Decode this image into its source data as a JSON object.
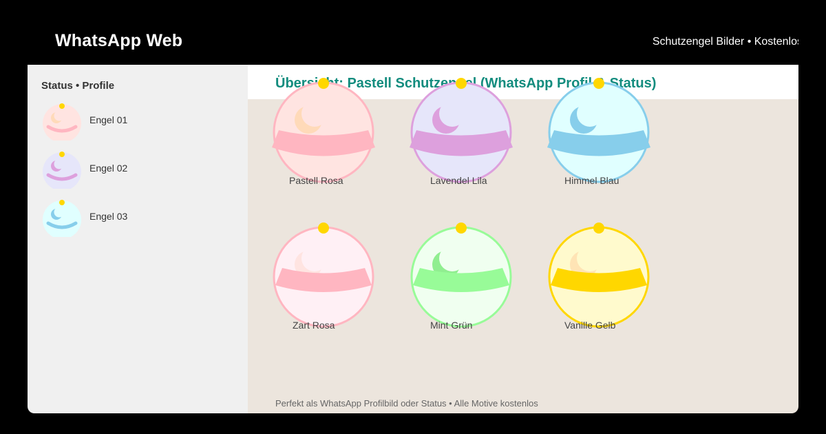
{
  "header": {
    "app_title": "WhatsApp Web",
    "right_text": "Schutzengel Bilder • Kostenlos"
  },
  "sidebar": {
    "title": "Status • Profile",
    "items": [
      {
        "label": "Engel 01",
        "fill": "#FFE4E1",
        "accent": "#FFB6C1",
        "moon": "#FFDAB9",
        "halo": "#FFD700"
      },
      {
        "label": "Engel 02",
        "fill": "#E6E6FA",
        "accent": "#DDA0DD",
        "moon": "#DDA0DD",
        "halo": "#FFD700"
      },
      {
        "label": "Engel 03",
        "fill": "#E0FFFF",
        "accent": "#87CEEB",
        "moon": "#87CEEB",
        "halo": "#FFD700"
      }
    ]
  },
  "main": {
    "title": "Übersicht: Pastell Schutzengel (WhatsApp Profil & Status)",
    "cards": [
      {
        "label": "Pastell Rosa",
        "fill": "#FFE4E1",
        "stroke": "#FFB6C1",
        "wing": "#FFB6C1",
        "moon": "#FFDAB9",
        "halo": "#FFD700"
      },
      {
        "label": "Lavendel Lila",
        "fill": "#E6E6FA",
        "stroke": "#DDA0DD",
        "wing": "#DDA0DD",
        "moon": "#DDA0DD",
        "halo": "#FFD700"
      },
      {
        "label": "Himmel Blau",
        "fill": "#E0FFFF",
        "stroke": "#87CEEB",
        "wing": "#87CEEB",
        "moon": "#87CEEB",
        "halo": "#FFD700"
      },
      {
        "label": "Zart Rosa",
        "fill": "#FFF0F5",
        "stroke": "#FFB6C1",
        "wing": "#FFB6C1",
        "moon": "#FFE4E1",
        "halo": "#FFD700"
      },
      {
        "label": "Mint Grün",
        "fill": "#F0FFF0",
        "stroke": "#98FB98",
        "wing": "#98FB98",
        "moon": "#90EE90",
        "halo": "#FFD700"
      },
      {
        "label": "Vanille Gelb",
        "fill": "#FFFACD",
        "stroke": "#FFD700",
        "wing": "#FFD700",
        "moon": "#FFE4B5",
        "halo": "#FFD700"
      }
    ],
    "footer_note": "Perfekt als WhatsApp Profilbild oder Status • Alle Motive kostenlos"
  },
  "icons": {
    "angel": "angel-icon"
  }
}
